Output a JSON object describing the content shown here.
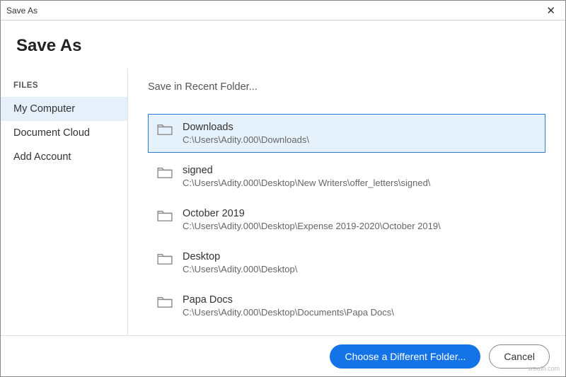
{
  "titlebar": {
    "title": "Save As"
  },
  "header": {
    "title": "Save As"
  },
  "sidebar": {
    "heading": "FILES",
    "items": [
      {
        "label": "My Computer",
        "active": true
      },
      {
        "label": "Document Cloud",
        "active": false
      },
      {
        "label": "Add Account",
        "active": false
      }
    ]
  },
  "main": {
    "heading": "Save in Recent Folder...",
    "folders": [
      {
        "name": "Downloads",
        "path": "C:\\Users\\Adity.000\\Downloads\\",
        "selected": true
      },
      {
        "name": "signed",
        "path": "C:\\Users\\Adity.000\\Desktop\\New Writers\\offer_letters\\signed\\",
        "selected": false
      },
      {
        "name": "October 2019",
        "path": "C:\\Users\\Adity.000\\Desktop\\Expense 2019-2020\\October 2019\\",
        "selected": false
      },
      {
        "name": "Desktop",
        "path": "C:\\Users\\Adity.000\\Desktop\\",
        "selected": false
      },
      {
        "name": "Papa Docs",
        "path": "C:\\Users\\Adity.000\\Desktop\\Documents\\Papa Docs\\",
        "selected": false
      }
    ]
  },
  "footer": {
    "primary": "Choose a Different Folder...",
    "secondary": "Cancel"
  },
  "watermark": "wsxdn.com"
}
